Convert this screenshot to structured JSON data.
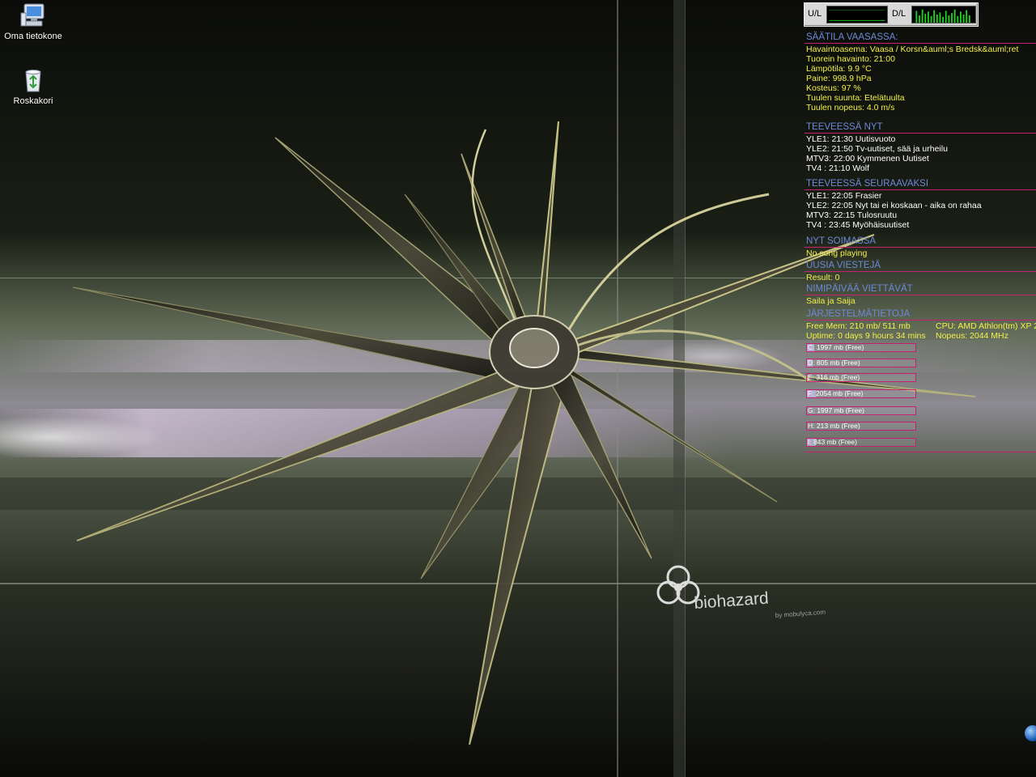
{
  "desktop_icons": [
    {
      "label": "Oma tietokone",
      "icon": "computer-icon"
    },
    {
      "label": "Roskakori",
      "icon": "recycle-bin-icon"
    }
  ],
  "net_monitor": {
    "upload_label": "U/L",
    "download_label": "D/L",
    "color": "#1fd41f"
  },
  "wallpaper": {
    "logo_text": "biohazard",
    "logo_subtext": "by mobulyca.com"
  },
  "weather": {
    "title": "SÄÄTILA VAASASSA:",
    "lines": [
      "Havaintoasema: Vaasa / Korsn&auml;s Bredsk&auml;ret",
      "Tuorein havainto: 21:00",
      "Lämpötila: 9.9 °C",
      "Paine: 998.9 hPa",
      "Kosteus: 97 %",
      "Tuulen suunta: Etelätuulta",
      "Tuulen nopeus: 4.0 m/s"
    ]
  },
  "tv_now": {
    "title": "TEEVEESSÄ NYT",
    "lines": [
      "YLE1: 21:30 Uutisvuoto",
      "YLE2: 21:50 Tv-uutiset, sää ja urheilu",
      "MTV3: 22:00 Kymmenen Uutiset",
      "TV4  : 21:10 Wolf"
    ]
  },
  "tv_next": {
    "title": "TEEVEESSÄ SEURAAVAKSI",
    "lines": [
      "YLE1: 22:05 Frasier",
      "YLE2: 22:05 Nyt tai ei koskaan - aika on rahaa",
      "MTV3: 22:15 Tulosruutu",
      "TV4  : 23:45 Myöhäisuutiset"
    ]
  },
  "now_playing": {
    "title": "NYT SOIMASSA",
    "lines": [
      "No song playing"
    ]
  },
  "new_messages": {
    "title": "UUSIA VIESTEJÄ",
    "lines": [
      "Result: 0"
    ]
  },
  "name_days": {
    "title": "NIMIPÄIVÄÄ VIETTÄVÄT",
    "lines": [
      "Saila ja Saija"
    ]
  },
  "system": {
    "title": "JÄRJESTELMÄTIETOJA",
    "free_mem": "Free Mem: 210 mb/ 511 mb",
    "uptime": "Uptime: 0 days 9 hours 34 mins",
    "cpu": "CPU: AMD Athlon(tm) XP 2",
    "speed": "Nopeus: 2044 MHz",
    "drives": [
      {
        "label": "C: 1997 mb (Free)",
        "fill": 0.07
      },
      {
        "label": "D: 805 mb (Free)",
        "fill": 0.05
      },
      {
        "label": "E: 316 mb (Free)",
        "fill": 0.0
      },
      {
        "label": "F: 2054 mb (Free)",
        "fill": 0.08
      },
      {
        "label": "G: 1997 mb (Free)",
        "fill": 0.0
      },
      {
        "label": "H: 213 mb (Free)",
        "fill": 0.0
      },
      {
        "label": "I: 843 mb (Free)",
        "fill": 0.08
      }
    ]
  }
}
